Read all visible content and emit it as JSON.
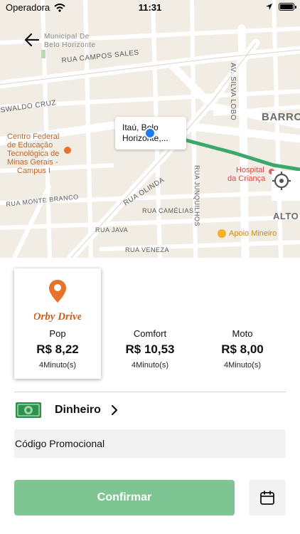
{
  "status_bar": {
    "carrier": "Operadora",
    "time": "11:31"
  },
  "map": {
    "labels": {
      "municipal_1": "Municipal De",
      "municipal_2": "Belo Horizonte",
      "rua_campos_sales": "RUA CAMPOS SALES",
      "swaldo_cruz": "SWALDO CRUZ",
      "av_silva_lobo": "AV. SILVA LOBO",
      "barroca": "BARROC",
      "cefet_1": "Centro Federal",
      "cefet_2": "de Educação",
      "cefet_3": "Tecnológica de",
      "cefet_4": "Minas Gerais -",
      "cefet_5": "Campus I",
      "hospital_1": "Hospital",
      "hospital_2": "da Criança",
      "alto": "ALTO",
      "rua_olinda": "RUA OLINDA",
      "rua_monte_branco": "RUA MONTE BRANCO",
      "rua_camelias": "RUA CAMÉLIAS",
      "rua_junquilhos": "RUA JUNQUILHOS",
      "rua_java": "RUA JAVA",
      "rua_veneza": "RUA VENEZA",
      "apoio_mineiro": "Apoio Mineiro"
    },
    "callout_line1": "Itaú, Belo",
    "callout_line2": "Horizonte,..."
  },
  "options": [
    {
      "name": "Pop",
      "price": "R$ 8,22",
      "eta": "4Minuto(s)",
      "selected": true,
      "logo_text": "Orby Drive"
    },
    {
      "name": "Comfort",
      "price": "R$ 10,53",
      "eta": "4Minuto(s)",
      "selected": false
    },
    {
      "name": "Moto",
      "price": "R$ 8,00",
      "eta": "4Minuto(s)",
      "selected": false
    }
  ],
  "payment": {
    "label": "Dinheiro"
  },
  "promo": {
    "label": "Código Promocional"
  },
  "confirm": {
    "label": "Confirmar"
  },
  "colors": {
    "accent": "#7fc593",
    "route": "#3aa86b",
    "pin": "#1e7bf0",
    "logo_orange": "#e8722a"
  },
  "icons": {
    "back": "arrow-left-icon",
    "locate": "crosshair-icon",
    "payment": "cash-icon",
    "chevron": "chevron-right-icon",
    "calendar": "calendar-icon"
  }
}
